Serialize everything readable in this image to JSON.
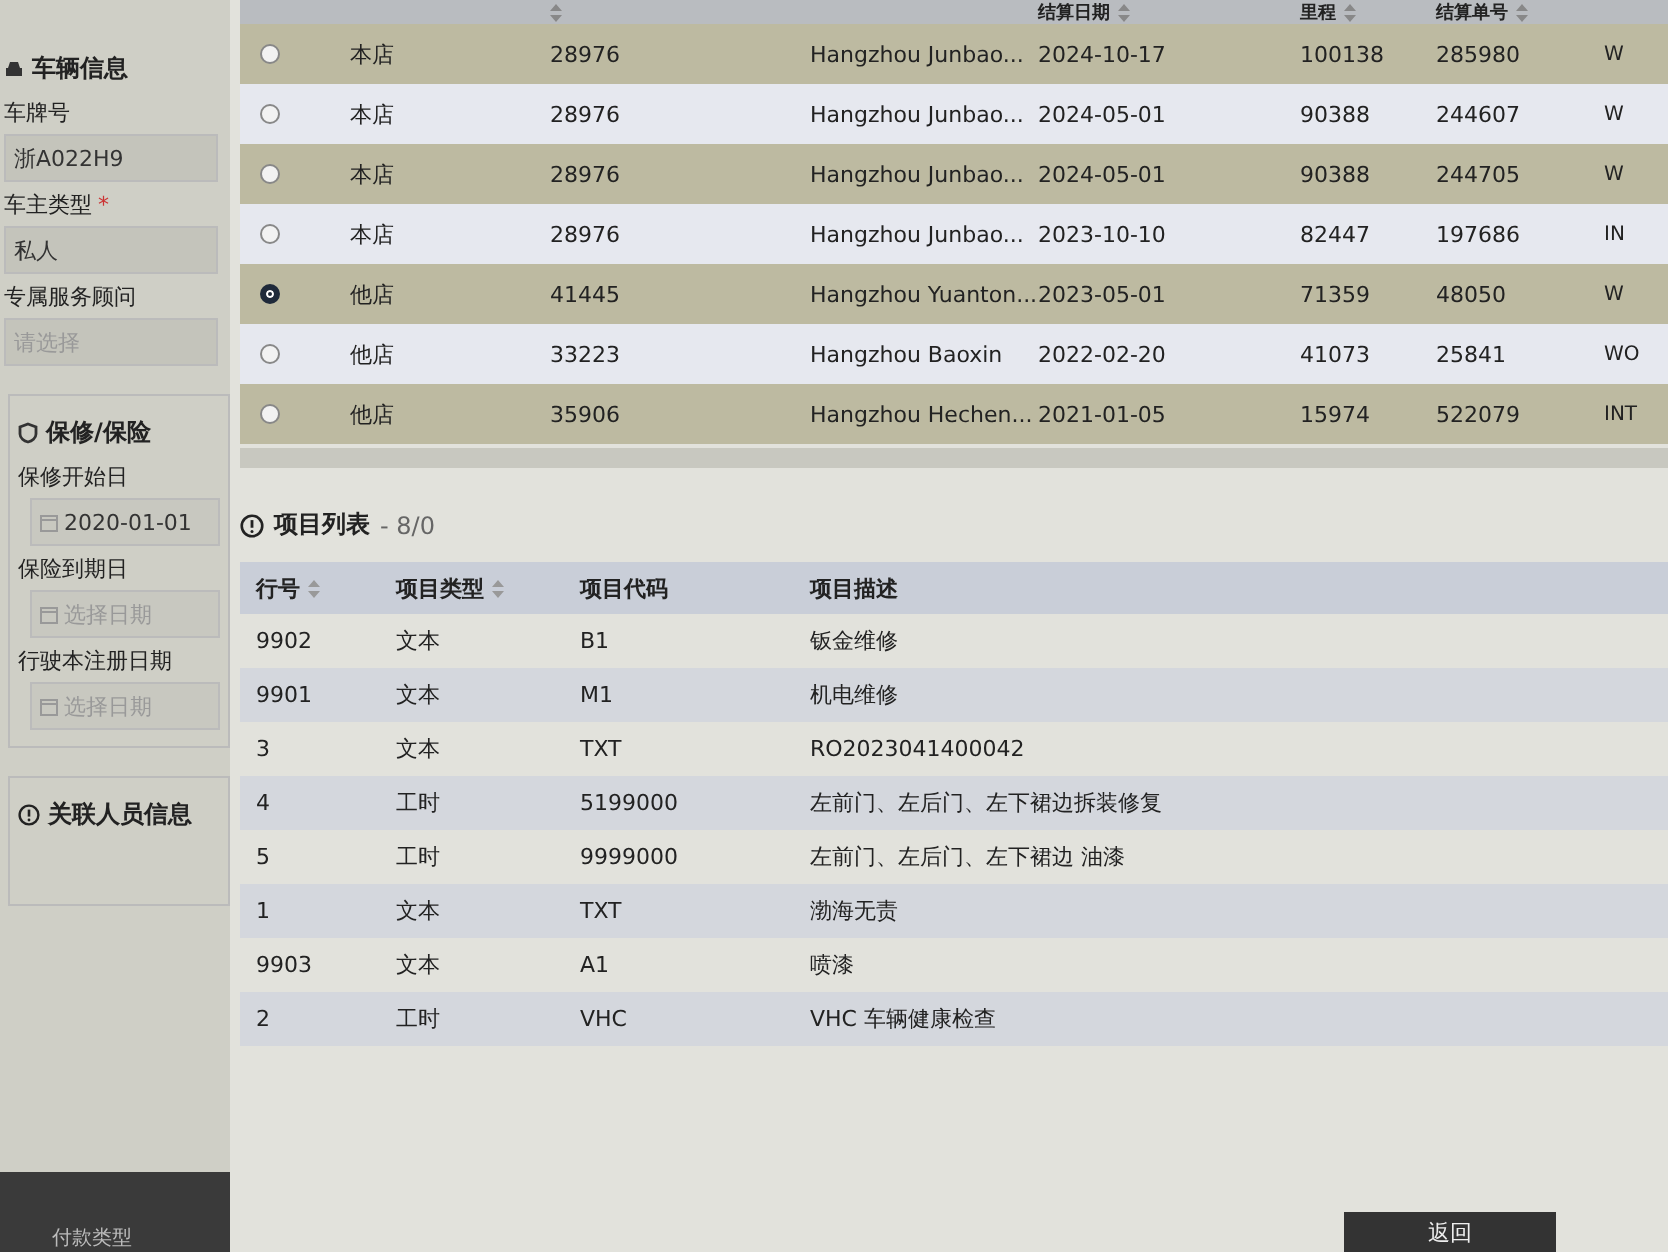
{
  "sidebar": {
    "vehicle_section": {
      "title": "车辆信息",
      "fields": [
        {
          "label": "车牌号",
          "value": "浙A022H9"
        },
        {
          "label": "车主类型",
          "value": "私人",
          "required_mark": "*"
        },
        {
          "label": "专属服务顾问",
          "placeholder": "请选择"
        }
      ]
    },
    "warranty_section": {
      "title": "保修/保险",
      "fields": [
        {
          "label": "保修开始日",
          "value": "2020-01-01"
        },
        {
          "label": "保险到期日",
          "placeholder": "选择日期"
        },
        {
          "label": "行驶本注册日期",
          "placeholder": "选择日期"
        }
      ]
    },
    "related_section": {
      "title": "关联人员信息"
    },
    "payment_label": "付款类型"
  },
  "history_table": {
    "columns": [
      {
        "sortable": false
      },
      {
        "sortable": true
      },
      {
        "sortable": false
      },
      {
        "label": "结算日期",
        "sortable": true
      },
      {
        "label": "里程",
        "sortable": true
      },
      {
        "label": "结算单号",
        "sortable": true
      },
      {
        "sortable": false
      }
    ],
    "rows": [
      {
        "selected": false,
        "cells": [
          "本店",
          "28976",
          "Hangzhou Junbao...",
          "2024-10-17",
          "100138",
          "285980",
          "W"
        ]
      },
      {
        "selected": false,
        "cells": [
          "本店",
          "28976",
          "Hangzhou Junbao...",
          "2024-05-01",
          "90388",
          "244607",
          "W"
        ]
      },
      {
        "selected": false,
        "cells": [
          "本店",
          "28976",
          "Hangzhou Junbao...",
          "2024-05-01",
          "90388",
          "244705",
          "W"
        ]
      },
      {
        "selected": false,
        "cells": [
          "本店",
          "28976",
          "Hangzhou Junbao...",
          "2023-10-10",
          "82447",
          "197686",
          "IN"
        ]
      },
      {
        "selected": true,
        "cells": [
          "他店",
          "41445",
          "Hangzhou Yuanton...",
          "2023-05-01",
          "71359",
          "48050",
          "W"
        ]
      },
      {
        "selected": false,
        "cells": [
          "他店",
          "33223",
          "Hangzhou Baoxin",
          "2022-02-20",
          "41073",
          "25841",
          "WO"
        ]
      },
      {
        "selected": false,
        "cells": [
          "他店",
          "35906",
          "Hangzhou Hechen...",
          "2021-01-05",
          "15974",
          "522079",
          "INT"
        ]
      }
    ]
  },
  "items_table": {
    "title": "项目列表",
    "count": "- 8/0",
    "columns": [
      {
        "label": "行号",
        "sortable": true
      },
      {
        "label": "项目类型",
        "sortable": true
      },
      {
        "label": "项目代码",
        "sortable": false
      },
      {
        "label": "项目描述",
        "sortable": false
      }
    ],
    "rows": [
      [
        "9902",
        "文本",
        "B1",
        "钣金维修"
      ],
      [
        "9901",
        "文本",
        "M1",
        "机电维修"
      ],
      [
        "3",
        "文本",
        "TXT",
        "RO2023041400042"
      ],
      [
        "4",
        "工时",
        "5199000",
        "左前门、左后门、左下裙边拆装修复"
      ],
      [
        "5",
        "工时",
        "9999000",
        "左前门、左后门、左下裙边 油漆"
      ],
      [
        "1",
        "文本",
        "TXT",
        "渤海无责"
      ],
      [
        "9903",
        "文本",
        "A1",
        "喷漆"
      ],
      [
        "2",
        "工时",
        "VHC",
        "VHC 车辆健康检查"
      ]
    ]
  },
  "back_button": "返回"
}
